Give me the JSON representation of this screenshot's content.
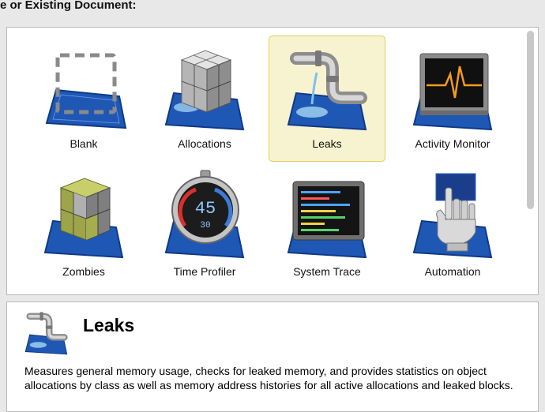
{
  "header": {
    "title": "e or Existing Document:"
  },
  "templates": [
    {
      "label": "Blank",
      "icon": "blank-template-icon"
    },
    {
      "label": "Allocations",
      "icon": "allocations-cube-icon"
    },
    {
      "label": "Leaks",
      "icon": "leaks-pipes-icon",
      "selected": true
    },
    {
      "label": "Activity Monitor",
      "icon": "activity-monitor-icon"
    },
    {
      "label": "Zombies",
      "icon": "zombies-cube-icon"
    },
    {
      "label": "Time Profiler",
      "icon": "time-profiler-stopwatch-icon"
    },
    {
      "label": "System Trace",
      "icon": "system-trace-icon"
    },
    {
      "label": "Automation",
      "icon": "automation-hand-icon"
    }
  ],
  "stopwatch": {
    "main": "45",
    "sub": "30"
  },
  "detail": {
    "title": "Leaks",
    "description": "Measures general memory usage, checks for leaked memory, and provides statistics on object allocations by class as well as memory address histories for all active allocations and leaked blocks."
  },
  "colors": {
    "selection_fill": "#f7f2cf",
    "selection_border": "#e2cf5a",
    "blueprint": "#1f57b5"
  }
}
